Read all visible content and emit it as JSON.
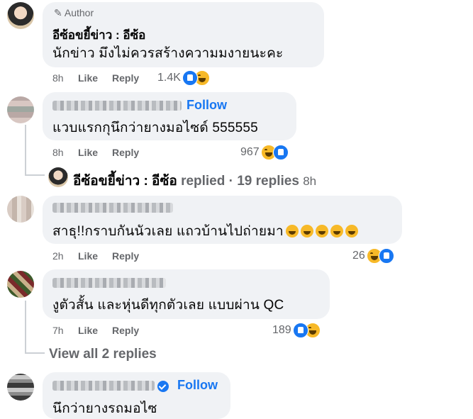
{
  "comments": [
    {
      "badge": "Author",
      "name": "อีซ้อขยี้ข่าว : อีซ้อ",
      "text": "นักข่าว มึงไม่ควรสร้างความมงายนะคะ",
      "time": "8h",
      "like": "Like",
      "reply": "Reply",
      "reactions": "1.4K"
    },
    {
      "follow": "Follow",
      "text": "แวบแรกกุนึกว่ายางมอไซด์ 555555",
      "time": "8h",
      "like": "Like",
      "reply": "Reply",
      "reactions": "967"
    },
    {
      "replied_name": "อีซ้อขยี้ข่าว : อีซ้อ",
      "replied_text": "replied · 19 replies",
      "replied_time": "8h"
    },
    {
      "text": "สาธุ!!กราบกันนัวเลย แถวบ้านไปถ่ายมา",
      "time": "2h",
      "like": "Like",
      "reply": "Reply",
      "reactions": "26"
    },
    {
      "text": "งูตัวสั้น และหุ่นดีทุกตัวเลย แบบผ่าน QC",
      "time": "7h",
      "like": "Like",
      "reply": "Reply",
      "reactions": "189"
    },
    {
      "view_replies": "View all 2 replies"
    },
    {
      "follow": "Follow",
      "text": "นึกว่ายางรถมอไซ"
    }
  ],
  "icons": {
    "author_badge": "pencil-icon",
    "like": "like-reaction-icon",
    "haha": "haha-reaction-icon",
    "verified": "verified-badge-icon"
  },
  "colors": {
    "link": "#1877f2",
    "bubble": "#f0f2f5",
    "meta": "#65676b"
  }
}
